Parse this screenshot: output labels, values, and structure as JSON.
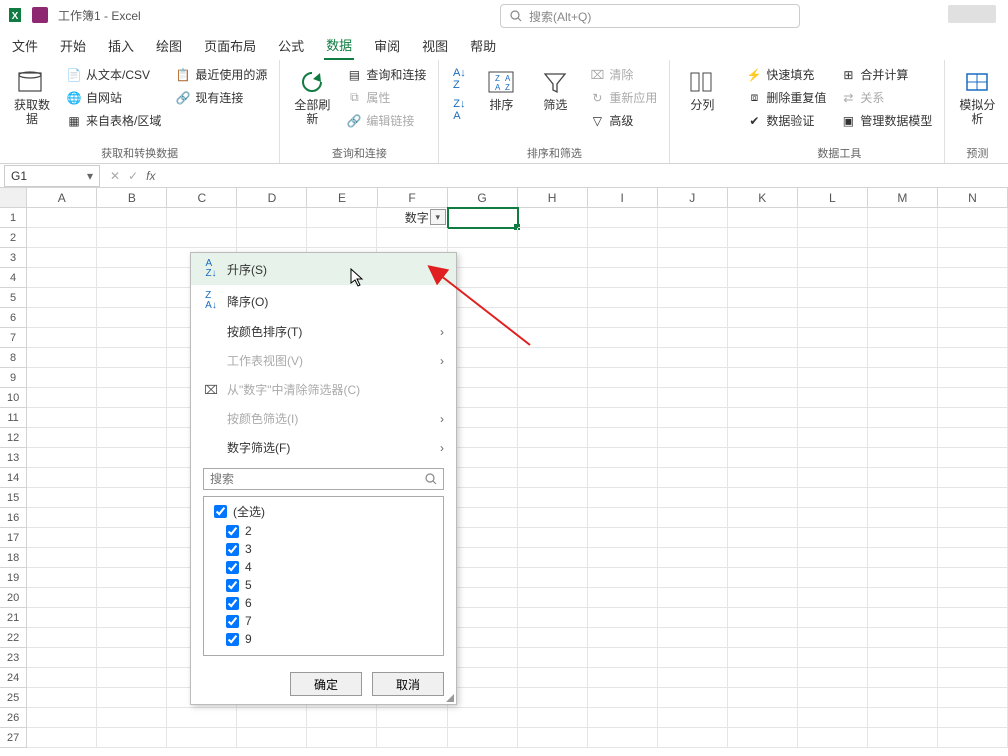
{
  "titlebar": {
    "title": "工作簿1 - Excel"
  },
  "search": {
    "placeholder": "搜索(Alt+Q)"
  },
  "tabs": [
    "文件",
    "开始",
    "插入",
    "绘图",
    "页面布局",
    "公式",
    "数据",
    "审阅",
    "视图",
    "帮助"
  ],
  "active_tab": "数据",
  "ribbon": {
    "g1": {
      "label": "获取和转换数据",
      "big": "获取数\n据",
      "items": [
        "从文本/CSV",
        "自网站",
        "来自表格/区域",
        "最近使用的源",
        "现有连接"
      ]
    },
    "g2": {
      "label": "查询和连接",
      "big": "全部刷新",
      "items": [
        "查询和连接",
        "属性",
        "编辑链接"
      ]
    },
    "g3": {
      "label": "排序和筛选",
      "sort": "排序",
      "filter": "筛选",
      "items": [
        "清除",
        "重新应用",
        "高级"
      ]
    },
    "g4": {
      "split": "分列"
    },
    "g5": {
      "label": "数据工具",
      "items": [
        "快速填充",
        "删除重复值",
        "数据验证",
        "合并计算",
        "关系",
        "管理数据模型"
      ]
    },
    "g6": {
      "label": "预测",
      "big": "模拟分析"
    }
  },
  "namebox": "G1",
  "columns": [
    "A",
    "B",
    "C",
    "D",
    "E",
    "F",
    "G",
    "H",
    "I",
    "J",
    "K",
    "L",
    "M",
    "N"
  ],
  "rowcount": 27,
  "f1": {
    "value": "数字"
  },
  "filter": {
    "asc": "升序(S)",
    "desc": "降序(O)",
    "colorSort": "按颜色排序(T)",
    "sheetView": "工作表视图(V)",
    "clear": "从\"数字\"中清除筛选器(C)",
    "colorFilter": "按颜色筛选(I)",
    "numFilter": "数字筛选(F)",
    "searchPlaceholder": "搜索",
    "checks": [
      "(全选)",
      "2",
      "3",
      "4",
      "5",
      "6",
      "7",
      "9"
    ],
    "ok": "确定",
    "cancel": "取消"
  }
}
